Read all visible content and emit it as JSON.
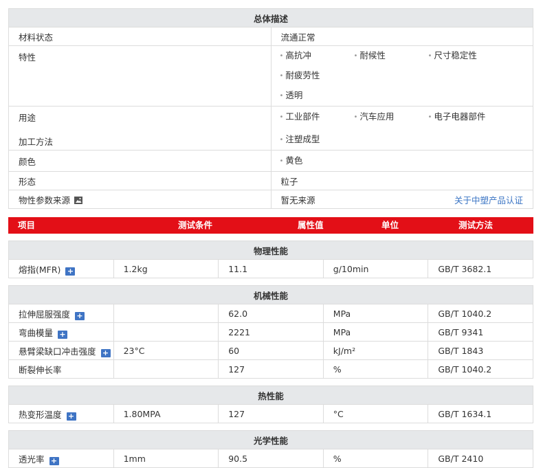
{
  "overview": {
    "title": "总体描述",
    "rows": [
      {
        "key": "材料状态",
        "value": "流通正常"
      },
      {
        "key": "特性",
        "tags": [
          "高抗冲",
          "耐候性",
          "尺寸稳定性",
          "耐疲劳性",
          "透明"
        ]
      },
      {
        "key": "用途",
        "tags": [
          "工业部件",
          "汽车应用",
          "电子电器部件"
        ]
      },
      {
        "key": "加工方法",
        "tags": [
          "注塑成型"
        ]
      },
      {
        "key": "颜色",
        "tags": [
          "黄色"
        ]
      },
      {
        "key": "形态",
        "value": "粒子"
      },
      {
        "key": "物性参数来源",
        "value": "暂无来源",
        "link": "关于中塑产品认证"
      }
    ]
  },
  "columns": [
    "项目",
    "测试条件",
    "属性值",
    "单位",
    "测试方法"
  ],
  "sections": [
    {
      "title": "物理性能",
      "rows": [
        {
          "name": "熔指(MFR)",
          "condition": "1.2kg",
          "value": "11.1",
          "unit": "g/10min",
          "method": "GB/T 3682.1"
        }
      ]
    },
    {
      "title": "机械性能",
      "rows": [
        {
          "name": "拉伸屈服强度",
          "condition": "",
          "value": "62.0",
          "unit": "MPa",
          "method": "GB/T 1040.2"
        },
        {
          "name": "弯曲模量",
          "condition": "",
          "value": "2221",
          "unit": "MPa",
          "method": "GB/T 9341"
        },
        {
          "name": "悬臂梁缺口冲击强度",
          "condition": "23°C",
          "value": "60",
          "unit": "kJ/m²",
          "method": "GB/T 1843"
        },
        {
          "name": "断裂伸长率",
          "condition": "",
          "value": "127",
          "unit": "%",
          "method": "GB/T 1040.2",
          "noicon": true
        }
      ]
    },
    {
      "title": "热性能",
      "rows": [
        {
          "name": "热变形温度",
          "condition": "1.80MPA",
          "value": "127",
          "unit": "°C",
          "method": "GB/T 1634.1"
        }
      ]
    },
    {
      "title": "光学性能",
      "rows": [
        {
          "name": "透光率",
          "condition": "1mm",
          "value": "90.5",
          "unit": "%",
          "method": "GB/T 2410"
        }
      ]
    }
  ],
  "icons": {
    "plus": "+",
    "plus_icon_name": "expand-plus-icon",
    "picture_icon_name": "picture-icon"
  },
  "colors": {
    "header_red": "#e30f17",
    "link_blue": "#3a74c4",
    "icon_blue": "#3f74c4",
    "section_gray": "#e6e8ea"
  }
}
